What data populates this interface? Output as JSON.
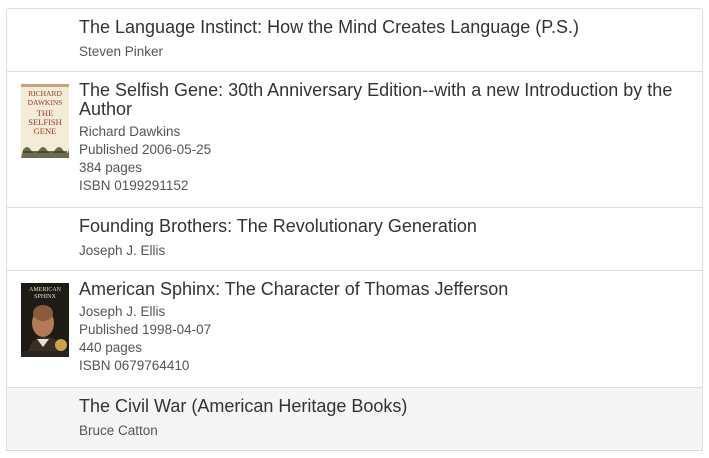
{
  "books": [
    {
      "title": "The Language Instinct: How the Mind Creates Language (P.S.)",
      "author": "Steven Pinker"
    },
    {
      "title": "The Selfish Gene: 30th Anniversary Edition--with a new Introduction by the Author",
      "author": "Richard Dawkins",
      "published": "Published 2006-05-25",
      "pages": "384 pages",
      "isbn": "ISBN 0199291152",
      "cover_text": [
        "RICHARD",
        "DAWKINS",
        "THE",
        "SELFISH",
        "GENE"
      ]
    },
    {
      "title": "Founding Brothers: The Revolutionary Generation",
      "author": "Joseph J. Ellis"
    },
    {
      "title": "American Sphinx: The Character of Thomas Jefferson",
      "author": "Joseph J. Ellis",
      "published": "Published 1998-04-07",
      "pages": "440 pages",
      "isbn": "ISBN 0679764410",
      "cover_text": [
        "AMERICAN",
        "SPHINX"
      ]
    },
    {
      "title": "The Civil War (American Heritage Books)",
      "author": "Bruce Catton"
    }
  ],
  "colors": {
    "border": "#dddddd",
    "hover_bg": "#f5f5f5",
    "title": "#333333",
    "meta": "#555555"
  }
}
